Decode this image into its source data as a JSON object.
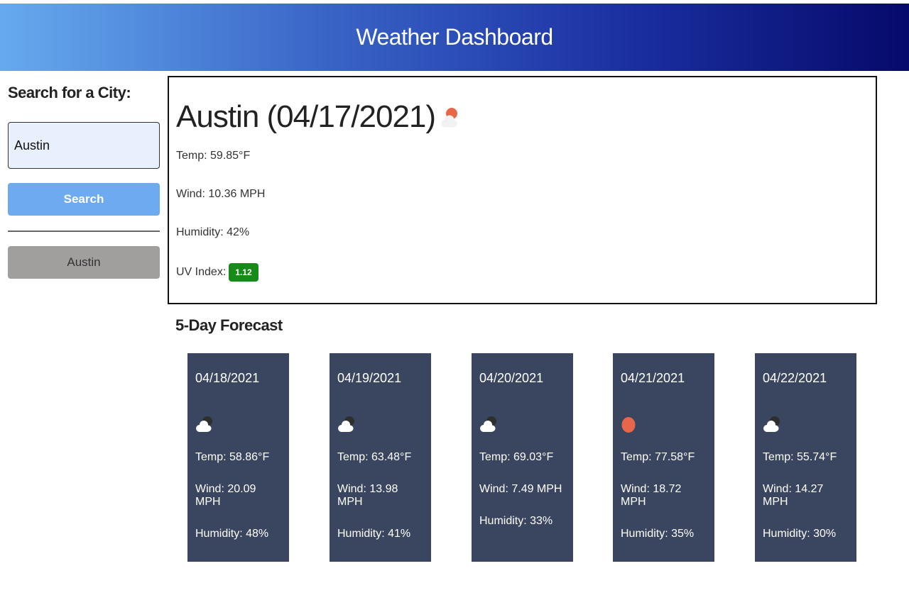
{
  "header": {
    "title": "Weather Dashboard"
  },
  "sidebar": {
    "title": "Search for a City:",
    "search_value": "Austin",
    "search_button_label": "Search",
    "history": [
      {
        "label": "Austin"
      }
    ]
  },
  "current": {
    "title": "Austin (04/17/2021)",
    "icon": "few-clouds-icon",
    "temp": "Temp: 59.85°F",
    "wind": "Wind: 10.36 MPH",
    "humidity": "Humidity: 42%",
    "uv_label": "UV Index:",
    "uv_value": "1.12",
    "uv_color": "#188a1a"
  },
  "forecast": {
    "title": "5-Day Forecast",
    "days": [
      {
        "date": "04/18/2021",
        "icon": "cloud-icon",
        "temp": "Temp: 58.86°F",
        "wind": "Wind: 20.09 MPH",
        "humidity": "Humidity: 48%"
      },
      {
        "date": "04/19/2021",
        "icon": "cloud-icon",
        "temp": "Temp: 63.48°F",
        "wind": "Wind: 13.98 MPH",
        "humidity": "Humidity: 41%"
      },
      {
        "date": "04/20/2021",
        "icon": "cloud-icon",
        "temp": "Temp: 69.03°F",
        "wind": "Wind: 7.49 MPH",
        "humidity": "Humidity: 33%"
      },
      {
        "date": "04/21/2021",
        "icon": "sun-icon",
        "temp": "Temp: 77.58°F",
        "wind": "Wind: 18.72 MPH",
        "humidity": "Humidity: 35%"
      },
      {
        "date": "04/22/2021",
        "icon": "cloud-icon",
        "temp": "Temp: 55.74°F",
        "wind": "Wind: 14.27 MPH",
        "humidity": "Humidity: 30%"
      }
    ]
  },
  "colors": {
    "card_bg": "#3a4560",
    "search_button": "#6eaaf0",
    "history_button": "#a19e9e",
    "sun": "#e8674a"
  }
}
